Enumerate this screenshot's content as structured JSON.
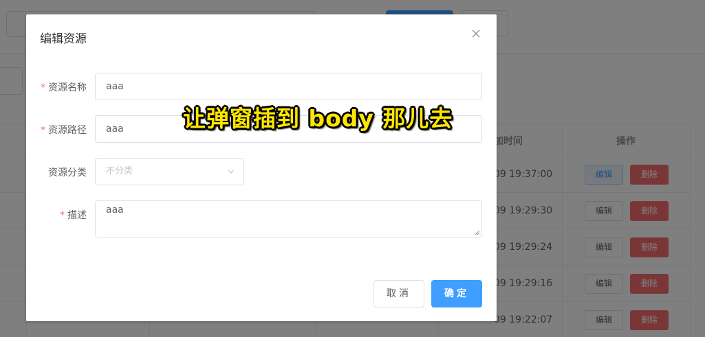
{
  "background": {
    "table": {
      "header_time": "加时间",
      "header_ops": "操作",
      "rows": [
        {
          "time": "09 19:37:00",
          "edit": "编辑",
          "delete": "删除",
          "edit_hover": true
        },
        {
          "time": "09 19:29:30",
          "edit": "编辑",
          "delete": "删除",
          "edit_hover": false
        },
        {
          "time": "09 19:29:24",
          "edit": "编辑",
          "delete": "删除",
          "edit_hover": false
        },
        {
          "time": "09 19:29:16",
          "edit": "编辑",
          "delete": "删除",
          "edit_hover": false
        },
        {
          "time": "09 19:22:07",
          "edit": "编辑",
          "delete": "删除",
          "edit_hover": false
        }
      ]
    }
  },
  "dialog": {
    "title": "编辑资源",
    "close_icon": "close-icon",
    "fields": {
      "name": {
        "label": "资源名称",
        "required": "*",
        "value": "aaa"
      },
      "path": {
        "label": "资源路径",
        "required": "*",
        "value": "aaa"
      },
      "category": {
        "label": "资源分类",
        "placeholder": "不分类"
      },
      "description": {
        "label": "描述",
        "required": "*",
        "value": "aaa"
      }
    },
    "buttons": {
      "cancel": "取消",
      "ok": "确定"
    }
  },
  "overlay_caption": "让弹窗插到 body 那儿去",
  "colors": {
    "primary": "#409eff",
    "danger": "#f56c6c",
    "required_star": "#f56c6c",
    "caption_fill": "#ffe600"
  }
}
